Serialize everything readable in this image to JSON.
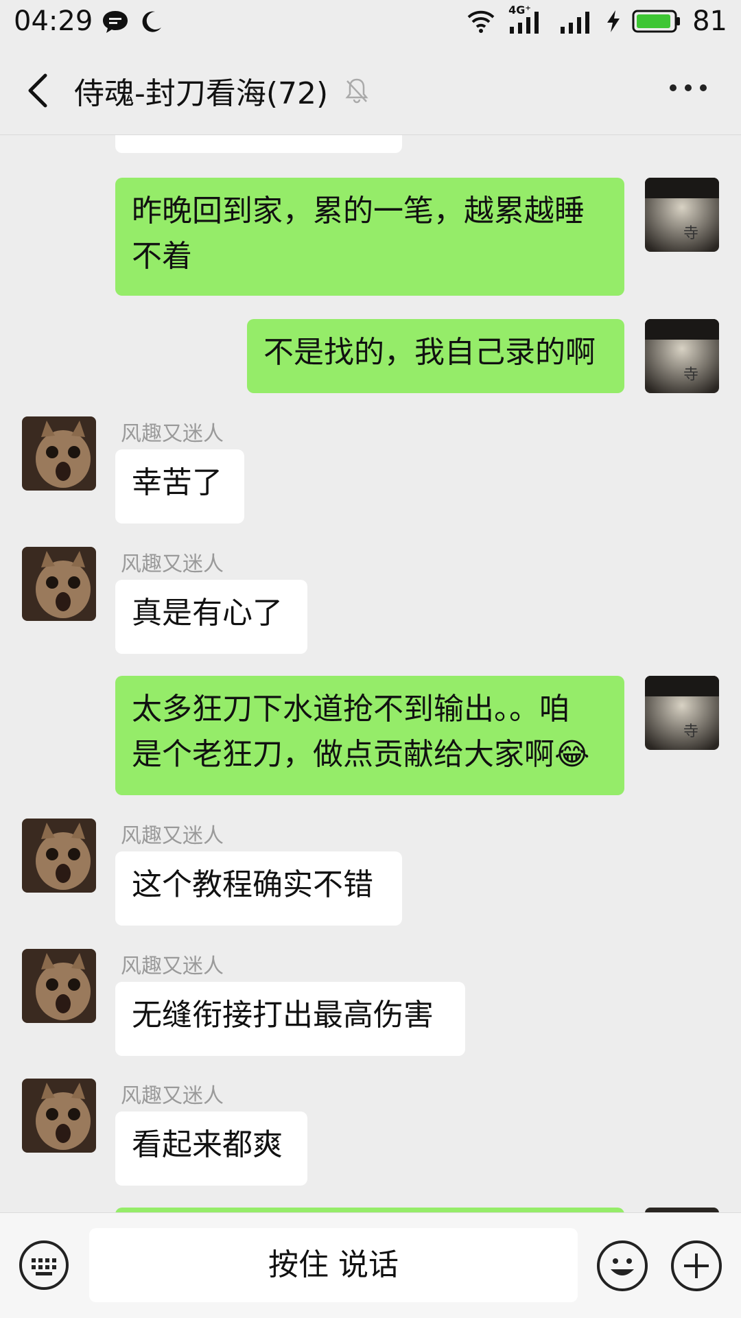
{
  "status_bar": {
    "time": "04:29",
    "network_label": "4G⁺",
    "battery": "81",
    "icons": [
      "chat-bubble-icon",
      "moon-icon",
      "wifi-icon",
      "signal-icon",
      "signal-icon",
      "charging-icon",
      "battery-icon"
    ]
  },
  "header": {
    "title": "侍魂-封刀看海(72)",
    "icons": [
      "back-icon",
      "mute-bell-icon",
      "more-icon"
    ]
  },
  "messages": [
    {
      "side": "right",
      "text_line1": "昨晚回到家，累的一笔，越累越睡",
      "text_line2": "不着"
    },
    {
      "side": "right",
      "text": "不是找的，我自己录的啊"
    },
    {
      "side": "left",
      "sender": "风趣又迷人",
      "text": "幸苦了"
    },
    {
      "side": "left",
      "sender": "风趣又迷人",
      "text": "真是有心了"
    },
    {
      "side": "right",
      "text_line1": "太多狂刀下水道抢不到输出。。咱",
      "text_line2": "是个老狂刀，做点贡献给大家啊",
      "emoji": "😂"
    },
    {
      "side": "left",
      "sender": "风趣又迷人",
      "text": "这个教程确实不错"
    },
    {
      "side": "left",
      "sender": "风趣又迷人",
      "text": "无缝衔接打出最高伤害"
    },
    {
      "side": "left",
      "sender": "风趣又迷人",
      "text": "看起来都爽"
    }
  ],
  "input_bar": {
    "voice_label": "按住 说话",
    "icons": [
      "keyboard-icon",
      "emoji-icon",
      "plus-icon"
    ]
  },
  "colors": {
    "background": "#ededed",
    "outgoing_bubble": "#95ec69",
    "incoming_bubble": "#ffffff",
    "sender_name": "#9a9a9a"
  }
}
